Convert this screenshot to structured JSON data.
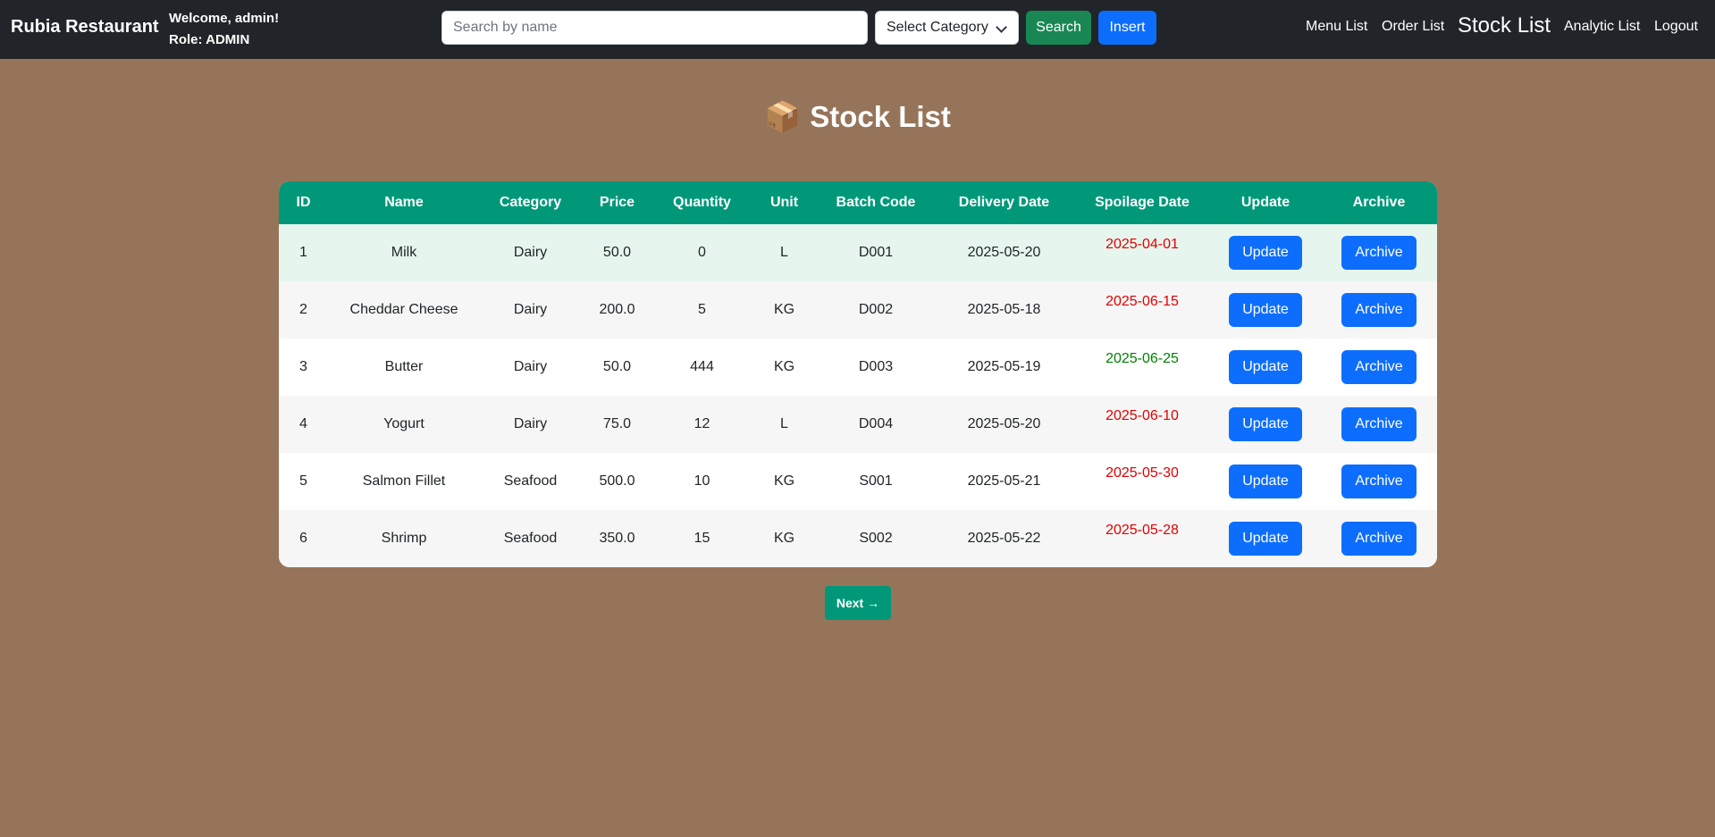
{
  "navbar": {
    "brand": "Rubia Restaurant",
    "welcome": "Welcome, admin!",
    "role": "Role: ADMIN",
    "search_placeholder": "Search by name",
    "category_select": "Select Category",
    "search_label": "Search",
    "insert_label": "Insert",
    "links": {
      "menu": "Menu List",
      "order": "Order List",
      "stock": "Stock List",
      "analytic": "Analytic List",
      "logout": "Logout"
    }
  },
  "page": {
    "title_icon": "📦",
    "title": "Stock List"
  },
  "colors": {
    "background": "#967459",
    "navbar": "#212529",
    "header": "#009879",
    "primary": "#0d6efd",
    "success": "#198754",
    "date_red": "#e00000",
    "date_green": "#008000"
  },
  "table": {
    "headers": [
      "ID",
      "Name",
      "Category",
      "Price",
      "Quantity",
      "Unit",
      "Batch Code",
      "Delivery Date",
      "Spoilage Date",
      "Update",
      "Archive"
    ],
    "update_label": "Update",
    "archive_label": "Archive",
    "rows": [
      {
        "id": "1",
        "name": "Milk",
        "category": "Dairy",
        "price": "50.0",
        "quantity": "0",
        "unit": "L",
        "batch": "D001",
        "delivery": "2025-05-20",
        "spoilage": "2025-04-01",
        "spoilage_status": "red"
      },
      {
        "id": "2",
        "name": "Cheddar Cheese",
        "category": "Dairy",
        "price": "200.0",
        "quantity": "5",
        "unit": "KG",
        "batch": "D002",
        "delivery": "2025-05-18",
        "spoilage": "2025-06-15",
        "spoilage_status": "red"
      },
      {
        "id": "3",
        "name": "Butter",
        "category": "Dairy",
        "price": "50.0",
        "quantity": "444",
        "unit": "KG",
        "batch": "D003",
        "delivery": "2025-05-19",
        "spoilage": "2025-06-25",
        "spoilage_status": "green"
      },
      {
        "id": "4",
        "name": "Yogurt",
        "category": "Dairy",
        "price": "75.0",
        "quantity": "12",
        "unit": "L",
        "batch": "D004",
        "delivery": "2025-05-20",
        "spoilage": "2025-06-10",
        "spoilage_status": "red"
      },
      {
        "id": "5",
        "name": "Salmon Fillet",
        "category": "Seafood",
        "price": "500.0",
        "quantity": "10",
        "unit": "KG",
        "batch": "S001",
        "delivery": "2025-05-21",
        "spoilage": "2025-05-30",
        "spoilage_status": "red"
      },
      {
        "id": "6",
        "name": "Shrimp",
        "category": "Seafood",
        "price": "350.0",
        "quantity": "15",
        "unit": "KG",
        "batch": "S002",
        "delivery": "2025-05-22",
        "spoilage": "2025-05-28",
        "spoilage_status": "red"
      }
    ]
  },
  "pagination": {
    "next_label": "Next →"
  }
}
